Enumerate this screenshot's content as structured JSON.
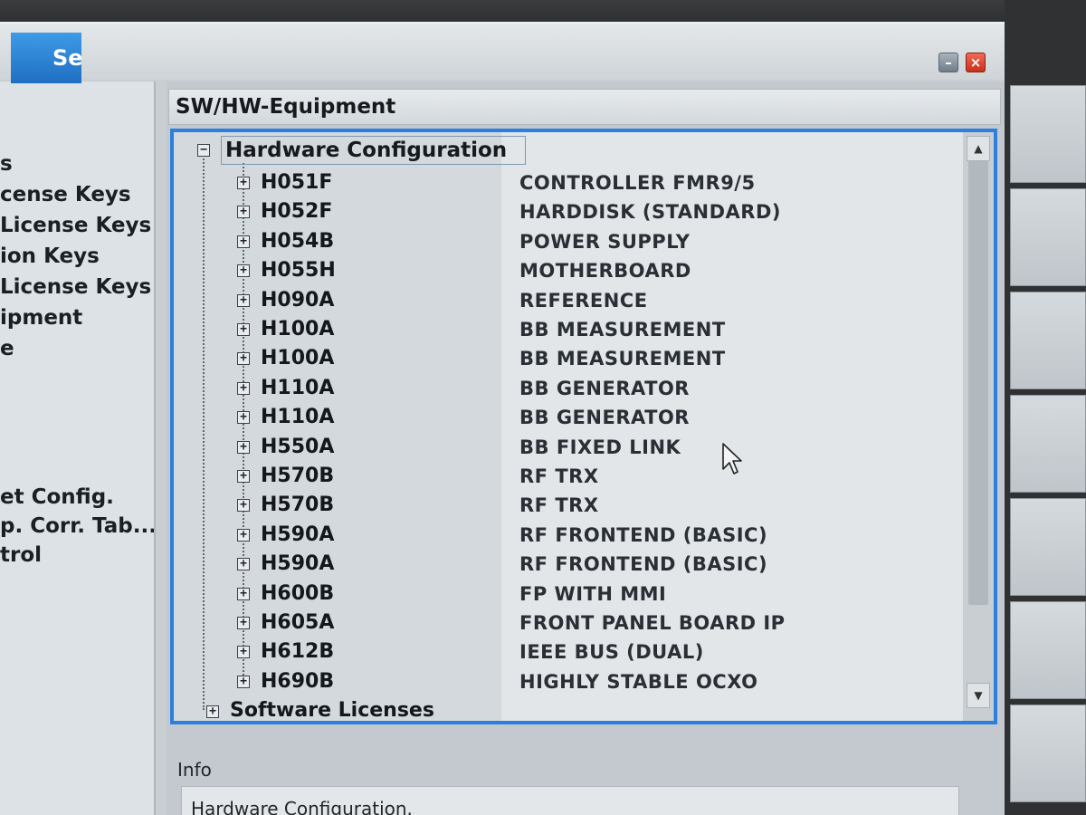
{
  "header": {
    "section_title": "SW/HW-Equipment"
  },
  "left_menu": {
    "items": [
      "s",
      "cense Keys",
      "License Keys",
      "ion Keys",
      "License Keys",
      "ipment",
      "e",
      "et Config.",
      "p. Corr. Tab...",
      "trol"
    ]
  },
  "tree": {
    "root_label": "Hardware Configuration",
    "root_toggle": "−",
    "child_toggle": "+",
    "rows": [
      {
        "code": "H051F",
        "desc": "CONTROLLER FMR9/5"
      },
      {
        "code": "H052F",
        "desc": "HARDDISK (STANDARD)"
      },
      {
        "code": "H054B",
        "desc": "POWER SUPPLY"
      },
      {
        "code": "H055H",
        "desc": "MOTHERBOARD"
      },
      {
        "code": "H090A",
        "desc": "REFERENCE"
      },
      {
        "code": "H100A",
        "desc": "BB MEASUREMENT"
      },
      {
        "code": "H100A",
        "desc": "BB MEASUREMENT"
      },
      {
        "code": "H110A",
        "desc": "BB GENERATOR"
      },
      {
        "code": "H110A",
        "desc": "BB GENERATOR"
      },
      {
        "code": "H550A",
        "desc": "BB FIXED LINK"
      },
      {
        "code": "H570B",
        "desc": "RF TRX"
      },
      {
        "code": "H570B",
        "desc": "RF TRX"
      },
      {
        "code": "H590A",
        "desc": "RF FRONTEND (BASIC)"
      },
      {
        "code": "H590A",
        "desc": "RF FRONTEND (BASIC)"
      },
      {
        "code": "H600B",
        "desc": "FP WITH MMI"
      },
      {
        "code": "H605A",
        "desc": "FRONT PANEL BOARD IP"
      },
      {
        "code": "H612B",
        "desc": "IEEE BUS (DUAL)"
      },
      {
        "code": "H690B",
        "desc": "HIGHLY STABLE OCXO"
      }
    ],
    "software_label": "Software Licenses",
    "scroll_up": "▲",
    "scroll_down": "▼"
  },
  "info": {
    "label": "Info",
    "text": "Hardware Configuration."
  },
  "softkeys": {
    "top_label": "Se"
  },
  "colors": {
    "accent": "#2a7fe0",
    "close_button": "#d9422b"
  }
}
